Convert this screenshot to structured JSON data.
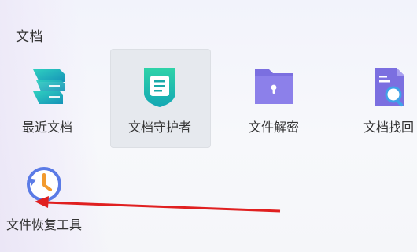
{
  "section": {
    "title": "文档"
  },
  "items": [
    {
      "label": "最近文档",
      "icon": "recent-docs-icon",
      "color": "#1fb3b0"
    },
    {
      "label": "文档守护者",
      "icon": "doc-guardian-icon",
      "color": "#19b5a8",
      "selected": true
    },
    {
      "label": "文件解密",
      "icon": "file-decrypt-icon",
      "color": "#7b6fe0"
    },
    {
      "label": "文档找回",
      "icon": "doc-retrieve-icon",
      "color": "#7b6fe0"
    },
    {
      "label": "文件恢复工具",
      "icon": "file-recovery-icon",
      "color": "#5b7be6"
    }
  ],
  "colors": {
    "accent_purple": "#7b6fe0",
    "accent_teal": "#1fb3b0",
    "arrow_red": "#e02020",
    "clock_orange": "#f29a2e"
  }
}
